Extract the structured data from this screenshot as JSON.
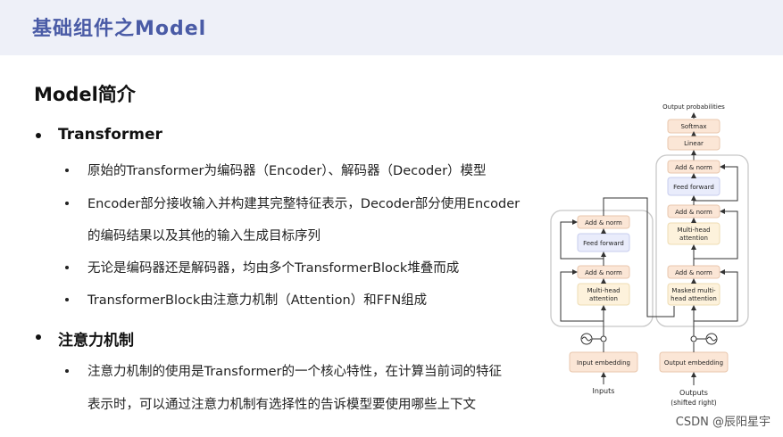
{
  "header": {
    "title": "基础组件之Model"
  },
  "section": {
    "title": "Model简介"
  },
  "bullets": [
    {
      "label": "Transformer",
      "subs": [
        "原始的Transformer为编码器（Encoder）、解码器（Decoder）模型",
        "Encoder部分接收输入并构建其完整特征表示，Decoder部分使用Encoder",
        "的编码结果以及其他的输入生成目标序列",
        "无论是编码器还是解码器，均由多个TransformerBlock堆叠而成",
        "TransformerBlock由注意力机制（Attention）和FFN组成"
      ]
    },
    {
      "label": "注意力机制",
      "subs": [
        "注意力机制的使用是Transformer的一个核心特性，在计算当前词的特征",
        "表示时，可以通过注意力机制有选择性的告诉模型要使用哪些上下文"
      ]
    }
  ],
  "diagram": {
    "output_probabilities": "Output probabilities",
    "softmax": "Softmax",
    "linear": "Linear",
    "add_norm": "Add & norm",
    "feed_forward": "Feed forward",
    "multi_head_attention_1": "Multi-head",
    "multi_head_attention_2": "attention",
    "masked_1": "Masked multi-",
    "masked_2": "head attention",
    "input_embedding": "Input embedding",
    "output_embedding": "Output embedding",
    "inputs": "Inputs",
    "outputs": "Outputs",
    "shifted_right": "(shifted right)"
  },
  "watermark": "CSDN @辰阳星宇"
}
